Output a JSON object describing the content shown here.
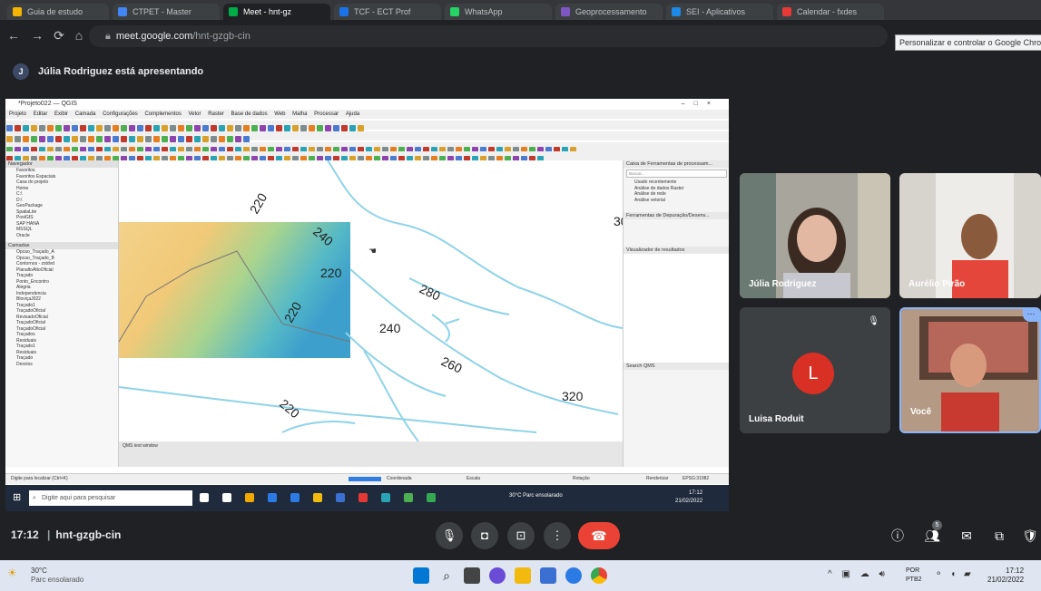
{
  "browser": {
    "tabs": [
      {
        "label": "Guia de estudo"
      },
      {
        "label": "CTPET - Master"
      },
      {
        "label": "Meet - hnt-gz"
      },
      {
        "label": "TCF - ECT Prof"
      },
      {
        "label": "WhatsApp"
      },
      {
        "label": "Geoprocessamento"
      },
      {
        "label": "SEI - Aplicativos"
      },
      {
        "label": "Calendar - fxdes"
      }
    ],
    "url_host": "meet.google.com",
    "url_path": "/hnt-gzgb-cin",
    "tooltip": "Personalizar e controlar o Google Chrome"
  },
  "meet": {
    "presenter_initial": "J",
    "presenter_text": "Júlia Rodriguez está apresentando",
    "time": "17:12",
    "separator": "|",
    "meeting_code": "hnt-gzgb-cin",
    "participants": [
      {
        "name": "Júlia Rodriguez"
      },
      {
        "name": "Aurélio Pirão"
      },
      {
        "name": "Luisa Roduit",
        "initial": "L"
      },
      {
        "name": "Você"
      }
    ],
    "people_count": "5"
  },
  "qgis": {
    "window_title": "*Projeto022 — QGIS",
    "menu": [
      "Projeto",
      "Editar",
      "Exibir",
      "Camada",
      "Configurações",
      "Complementos",
      "Vetor",
      "Raster",
      "Base de dados",
      "Web",
      "Malha",
      "Processar",
      "Ajuda"
    ],
    "browser_panel_title": "Navegador",
    "browser_items": [
      "Favoritos",
      "Favoritos Espaciais",
      "Casa do projeto",
      "Home",
      "C:\\",
      "D:\\",
      "GeoPackage",
      "SpatiaLite",
      "PostGIS",
      "SAP HANA",
      "MSSQL",
      "Oracle"
    ],
    "layers_panel_title": "Camadas",
    "layers": [
      "Opcao_Traçado_A",
      "Opcao_Traçado_B",
      "Contornos - zstdvd",
      "PlanaltoAltoOficial",
      "Traçado",
      "Ponto_Encontro",
      "Alegria",
      "Independencia",
      "BloviçaJ022",
      "Traçado1",
      "TraçadoOficial",
      "RevisadoOficial",
      "TraçadoOficial",
      "TraçadoOficial",
      "Traçados",
      "Residuais",
      "Traçado1",
      "Residuais",
      "Traçado",
      "Desvios"
    ],
    "contour_labels": [
      "220",
      "240",
      "220",
      "220",
      "280",
      "240",
      "260",
      "320",
      "220",
      "30"
    ],
    "toolbox_title": "Caixa de Ferramentas de processam...",
    "toolbox_search": "Buscar...",
    "toolbox_items": [
      "Usado recentemente",
      "Análise de dados Raster",
      "Análise de rede",
      "Análise vetorial"
    ],
    "debug_title": "Ferramentas de Depuração/Desenv...",
    "results_title": "Visualizador de resultados",
    "search_qms": "Search QMS",
    "console_title": "QMS test window",
    "status_search": "Digite para localizar (Ctrl+K)",
    "coordinate_label": "Coordenada",
    "scale_label": "Escala",
    "rotation_label": "Rotação",
    "renderizar": "Renderizar",
    "crs": "EPSG:31982"
  },
  "windows_inner": {
    "search_placeholder": "Digite aqui para pesquisar",
    "temp": "30°C  Parc ensolarado",
    "time": "17:12",
    "date": "21/02/2022"
  },
  "taskbar": {
    "temp": "30°C",
    "weather": "Parc ensolarado",
    "lang": "POR",
    "kbd": "PTB2",
    "time": "17:12",
    "date": "21/02/2022"
  }
}
